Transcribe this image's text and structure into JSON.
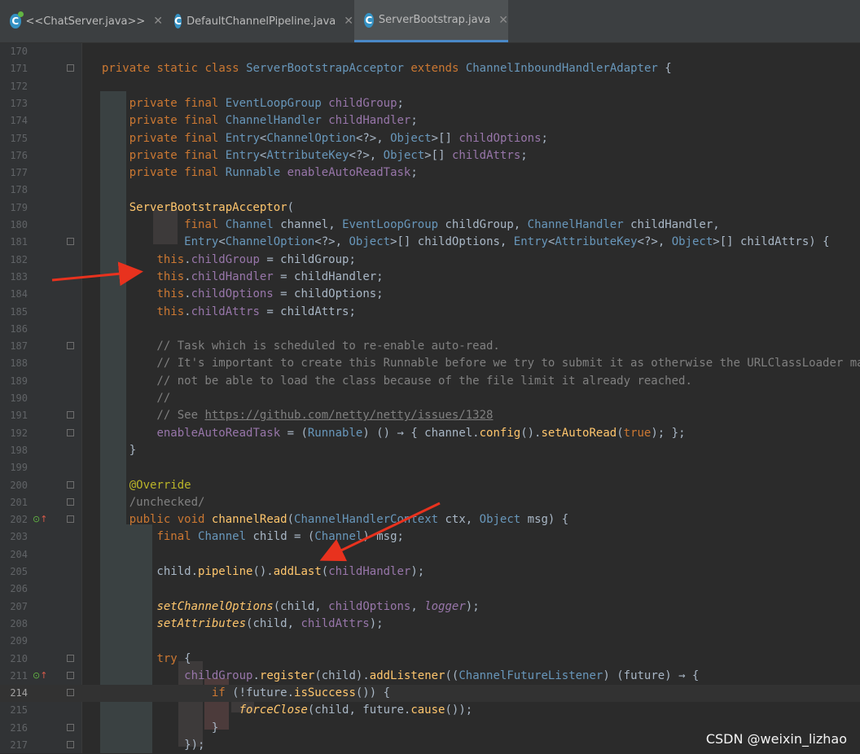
{
  "tabs": [
    {
      "label": "<<ChatServer.java>>",
      "icon": "java-class-icon",
      "active": false
    },
    {
      "label": "DefaultChannelPipeline.java",
      "icon": "java-class-icon",
      "active": false
    },
    {
      "label": "ServerBootstrap.java",
      "icon": "java-class-icon",
      "active": true
    }
  ],
  "close_glyph": "✕",
  "current_line": "214",
  "watermark": "CSDN @weixin_lizhao",
  "lines": [
    {
      "n": "170",
      "text": ""
    },
    {
      "n": "171",
      "text": "private static class ServerBootstrapAcceptor extends ChannelInboundHandlerAdapter {"
    },
    {
      "n": "172",
      "text": ""
    },
    {
      "n": "173",
      "text": "    private final EventLoopGroup childGroup;"
    },
    {
      "n": "174",
      "text": "    private final ChannelHandler childHandler;"
    },
    {
      "n": "175",
      "text": "    private final Entry<ChannelOption<?>, Object>[] childOptions;"
    },
    {
      "n": "176",
      "text": "    private final Entry<AttributeKey<?>, Object>[] childAttrs;"
    },
    {
      "n": "177",
      "text": "    private final Runnable enableAutoReadTask;"
    },
    {
      "n": "178",
      "text": ""
    },
    {
      "n": "179",
      "text": "    ServerBootstrapAcceptor("
    },
    {
      "n": "180",
      "text": "            final Channel channel, EventLoopGroup childGroup, ChannelHandler childHandler,"
    },
    {
      "n": "181",
      "text": "            Entry<ChannelOption<?>, Object>[] childOptions, Entry<AttributeKey<?>, Object>[] childAttrs) {"
    },
    {
      "n": "182",
      "text": "        this.childGroup = childGroup;"
    },
    {
      "n": "183",
      "text": "        this.childHandler = childHandler;"
    },
    {
      "n": "184",
      "text": "        this.childOptions = childOptions;"
    },
    {
      "n": "185",
      "text": "        this.childAttrs = childAttrs;"
    },
    {
      "n": "186",
      "text": ""
    },
    {
      "n": "187",
      "text": "        // Task which is scheduled to re-enable auto-read."
    },
    {
      "n": "188",
      "text": "        // It's important to create this Runnable before we try to submit it as otherwise the URLClassLoader may"
    },
    {
      "n": "189",
      "text": "        // not be able to load the class because of the file limit it already reached."
    },
    {
      "n": "190",
      "text": "        //"
    },
    {
      "n": "191",
      "text": "        // See https://github.com/netty/netty/issues/1328"
    },
    {
      "n": "192",
      "text": "        enableAutoReadTask = (Runnable) () → { channel.config().setAutoRead(true); };"
    },
    {
      "n": "198",
      "text": "    }"
    },
    {
      "n": "199",
      "text": ""
    },
    {
      "n": "200",
      "text": "    @Override"
    },
    {
      "n": "201",
      "text": "    /unchecked/"
    },
    {
      "n": "202",
      "text": "    public void channelRead(ChannelHandlerContext ctx, Object msg) {"
    },
    {
      "n": "203",
      "text": "        final Channel child = (Channel) msg;"
    },
    {
      "n": "204",
      "text": ""
    },
    {
      "n": "205",
      "text": "        child.pipeline().addLast(childHandler);"
    },
    {
      "n": "206",
      "text": ""
    },
    {
      "n": "207",
      "text": "        setChannelOptions(child, childOptions, logger);"
    },
    {
      "n": "208",
      "text": "        setAttributes(child, childAttrs);"
    },
    {
      "n": "209",
      "text": ""
    },
    {
      "n": "210",
      "text": "        try {"
    },
    {
      "n": "211",
      "text": "            childGroup.register(child).addListener((ChannelFutureListener) (future) → {"
    },
    {
      "n": "214",
      "text": "                if (!future.isSuccess()) {"
    },
    {
      "n": "215",
      "text": "                    forceClose(child, future.cause());"
    },
    {
      "n": "216",
      "text": "                }"
    },
    {
      "n": "217",
      "text": "            });"
    }
  ]
}
